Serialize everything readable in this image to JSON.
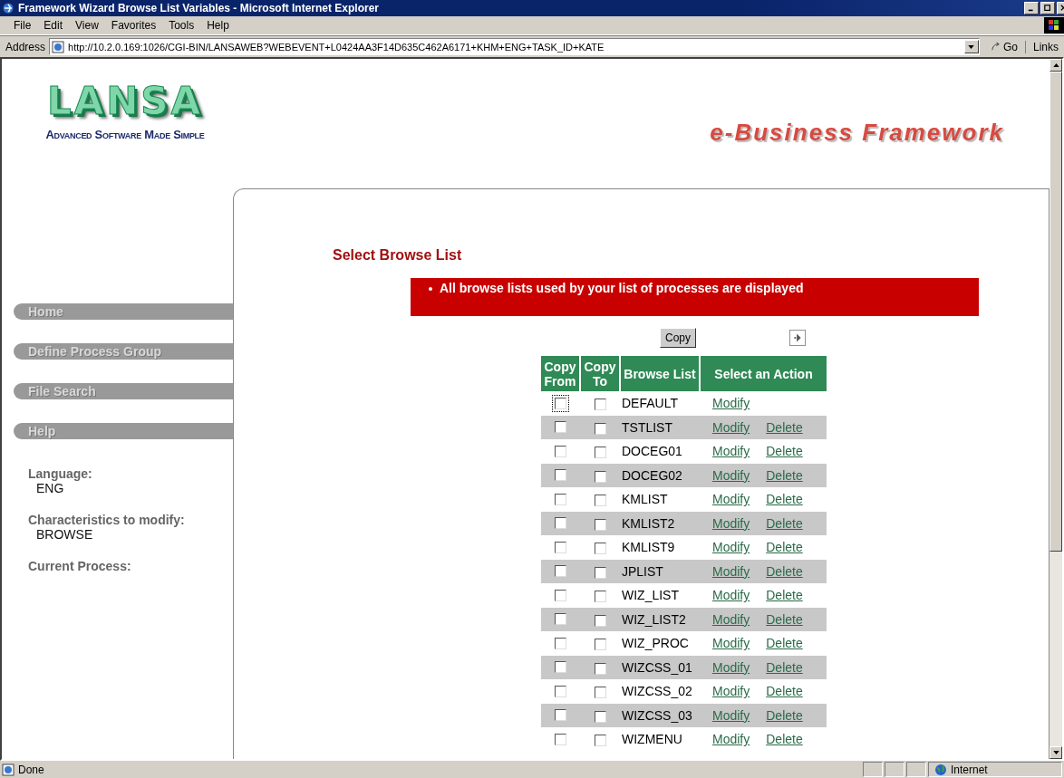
{
  "window": {
    "title": "Framework Wizard Browse List Variables - Microsoft Internet Explorer"
  },
  "menu": [
    "File",
    "Edit",
    "View",
    "Favorites",
    "Tools",
    "Help"
  ],
  "address_bar": {
    "label": "Address",
    "value": "http://10.2.0.169:1026/CGI-BIN/LANSAWEB?WEBEVENT+L0424AA3F14D635C462A6171+KHM+ENG+TASK_ID+KATE",
    "go": "Go",
    "links": "Links"
  },
  "logo": {
    "name": "LANSA",
    "tagline": "Advanced Software Made Simple"
  },
  "banner": "e-Business Framework",
  "sidebar": {
    "items": [
      "Home",
      "Define Process Group",
      "File Search",
      "Help"
    ],
    "info": [
      {
        "label": "Language:",
        "value": "ENG"
      },
      {
        "label": "Characteristics to modify:",
        "value": "BROWSE"
      },
      {
        "label": "Current Process:"
      }
    ]
  },
  "page_title": "Select Browse List",
  "message": "All browse lists used by your list of processes are displayed",
  "copy_button": "Copy",
  "table": {
    "columns": [
      "Copy From",
      "Copy To",
      "Browse List",
      "Select an Action"
    ],
    "rows": [
      {
        "copy_from": false,
        "copy_to": false,
        "focused": true,
        "name": "DEFAULT",
        "actions": [
          "Modify"
        ]
      },
      {
        "copy_from": false,
        "copy_to": false,
        "focused": false,
        "name": "TSTLIST",
        "actions": [
          "Modify",
          "Delete"
        ]
      },
      {
        "copy_from": false,
        "copy_to": false,
        "focused": false,
        "name": "DOCEG01",
        "actions": [
          "Modify",
          "Delete"
        ]
      },
      {
        "copy_from": false,
        "copy_to": false,
        "focused": false,
        "name": "DOCEG02",
        "actions": [
          "Modify",
          "Delete"
        ]
      },
      {
        "copy_from": false,
        "copy_to": false,
        "focused": false,
        "name": "KMLIST",
        "actions": [
          "Modify",
          "Delete"
        ]
      },
      {
        "copy_from": false,
        "copy_to": false,
        "focused": false,
        "name": "KMLIST2",
        "actions": [
          "Modify",
          "Delete"
        ]
      },
      {
        "copy_from": false,
        "copy_to": false,
        "focused": false,
        "name": "KMLIST9",
        "actions": [
          "Modify",
          "Delete"
        ]
      },
      {
        "copy_from": false,
        "copy_to": false,
        "focused": false,
        "name": "JPLIST",
        "actions": [
          "Modify",
          "Delete"
        ]
      },
      {
        "copy_from": false,
        "copy_to": false,
        "focused": false,
        "name": "WIZ_LIST",
        "actions": [
          "Modify",
          "Delete"
        ]
      },
      {
        "copy_from": false,
        "copy_to": false,
        "focused": false,
        "name": "WIZ_LIST2",
        "actions": [
          "Modify",
          "Delete"
        ]
      },
      {
        "copy_from": false,
        "copy_to": false,
        "focused": false,
        "name": "WIZ_PROC",
        "actions": [
          "Modify",
          "Delete"
        ]
      },
      {
        "copy_from": false,
        "copy_to": false,
        "focused": false,
        "name": "WIZCSS_01",
        "actions": [
          "Modify",
          "Delete"
        ]
      },
      {
        "copy_from": false,
        "copy_to": false,
        "focused": false,
        "name": "WIZCSS_02",
        "actions": [
          "Modify",
          "Delete"
        ]
      },
      {
        "copy_from": false,
        "copy_to": false,
        "focused": false,
        "name": "WIZCSS_03",
        "actions": [
          "Modify",
          "Delete"
        ]
      },
      {
        "copy_from": false,
        "copy_to": false,
        "focused": false,
        "name": "WIZMENU",
        "actions": [
          "Modify",
          "Delete"
        ]
      }
    ]
  },
  "status_bar": {
    "text": "Done",
    "zone": "Internet"
  }
}
